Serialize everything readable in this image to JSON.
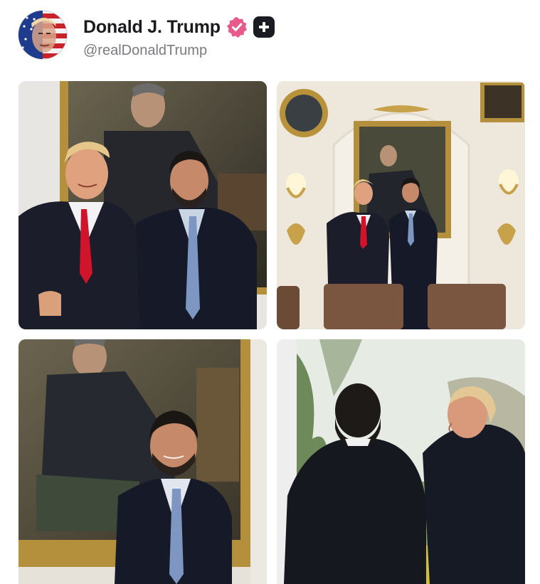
{
  "post": {
    "author": {
      "display_name": "Donald J. Trump",
      "handle": "@realDonaldTrump",
      "verified_icon": "verified-badge-icon",
      "plus_icon": "plus-badge-icon",
      "colors": {
        "verified": "#e85a8c",
        "plus_badge": "#1b1b24"
      }
    },
    "media": [
      {
        "name": "photo-portrait-two-men",
        "icon": "image-icon"
      },
      {
        "name": "photo-oval-room",
        "icon": "image-icon"
      },
      {
        "name": "photo-single-man-portrait",
        "icon": "image-icon"
      },
      {
        "name": "photo-window-backs",
        "icon": "image-icon"
      }
    ]
  }
}
